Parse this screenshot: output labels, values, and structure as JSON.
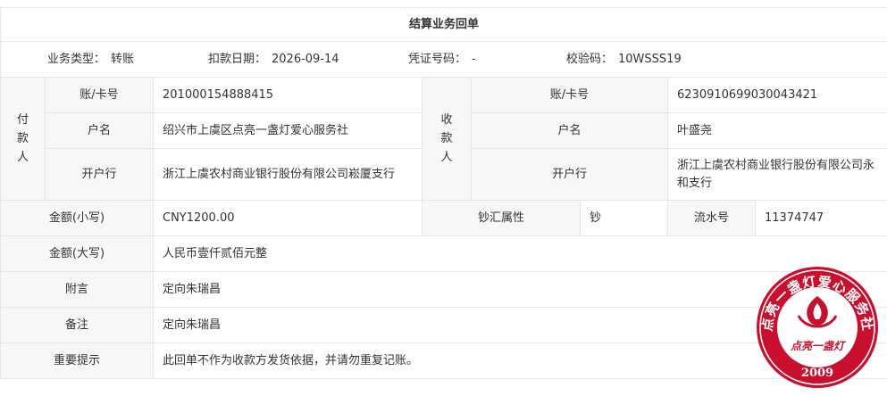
{
  "title": "结算业务回单",
  "info": {
    "type_label": "业务类型：",
    "type_value": "转账",
    "date_label": "扣款日期：",
    "date_value": "2026-09-14",
    "voucher_label": "凭证号码：",
    "voucher_value": "-",
    "check_label": "校验码：",
    "check_value": "10WSSS19"
  },
  "payer": {
    "label_chars": [
      "付",
      "款",
      "人"
    ],
    "account_label": "账/卡号",
    "account": "201000154888415",
    "name_label": "户名",
    "name": "绍兴市上虞区点亮一盏灯爱心服务社",
    "bank_label": "开户行",
    "bank": "浙江上虞农村商业银行股份有限公司崧厦支行"
  },
  "payee": {
    "label_chars": [
      "收",
      "款",
      "人"
    ],
    "account_label": "账/卡号",
    "account": "6230910699030043421",
    "name_label": "户名",
    "name": "叶盛尧",
    "bank_label": "开户行",
    "bank": "浙江上虞农村商业银行股份有限公司永和支行"
  },
  "amount_small_label": "金额(小写)",
  "amount_small": "CNY1200.00",
  "fx_label": "钞汇属性",
  "fx_value": "钞",
  "serial_label": "流水号",
  "serial_value": "11374747",
  "amount_big_label": "金额(大写)",
  "amount_big": "人民币壹仟贰佰元整",
  "postscript_label": "附言",
  "postscript": "定向朱瑞昌",
  "remark_label": "备注",
  "remark": "定向朱瑞昌",
  "notice_label": "重要提示",
  "notice": "此回单不作为收款方发货依据，并请勿重复记账。",
  "seal": {
    "text": "点亮一盏灯爱心服务社",
    "center_text": "点亮一盏灯",
    "year": "2009",
    "color": "#c8102e"
  }
}
